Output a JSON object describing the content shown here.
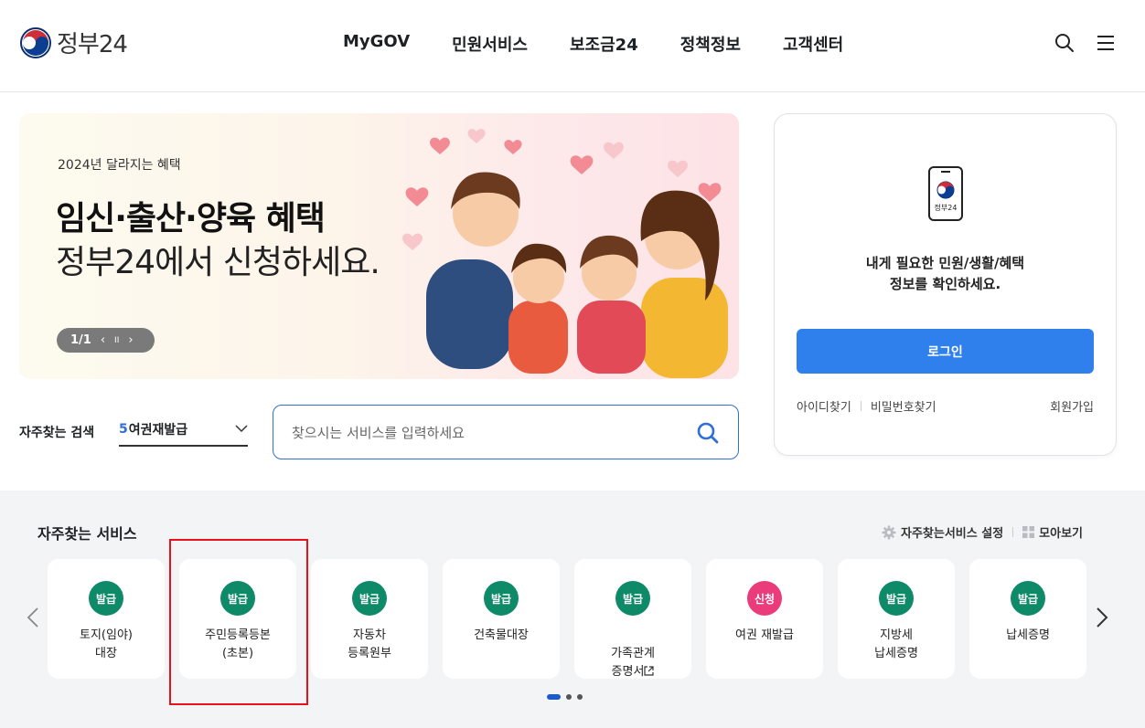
{
  "header": {
    "logo_text": "정부24",
    "nav": [
      "MyGOV",
      "민원서비스",
      "보조금24",
      "정책정보",
      "고객센터"
    ]
  },
  "banner": {
    "subtitle": "2024년 달라지는 혜택",
    "title": "임신·출산·양육 혜택",
    "title2": "정부24에서 신청하세요.",
    "counter": "1/1",
    "prev": "‹",
    "pause": "II",
    "next": "›"
  },
  "login": {
    "phone_label": "정부24",
    "message_line1": "내게 필요한 민원/생활/혜택",
    "message_line2": "정보를 확인하세요.",
    "button": "로그인",
    "find_id": "아이디찾기",
    "find_pw": "비밀번호찾기",
    "signup": "회원가입"
  },
  "search": {
    "label": "자주찾는 검색",
    "keyword_rank": "5",
    "keyword_text": "여권재발급",
    "placeholder": "찾으시는 서비스를 입력하세요"
  },
  "services": {
    "title": "자주찾는 서비스",
    "settings": "자주찾는서비스 설정",
    "view_all": "모아보기",
    "cards": [
      {
        "badge": "발급",
        "label": "토지(임야)\n대장"
      },
      {
        "badge": "발급",
        "label": "주민등록등본\n(초본)"
      },
      {
        "badge": "발급",
        "label": "자동차\n등록원부"
      },
      {
        "badge": "발급",
        "label": "건축물대장"
      },
      {
        "badge": "발급",
        "label": "가족관계\n증명서"
      },
      {
        "badge": "신청",
        "label": "여권 재발급"
      },
      {
        "badge": "발급",
        "label": "지방세\n납세증명"
      },
      {
        "badge": "발급",
        "label": "납세증명"
      }
    ],
    "pagination_active": 1,
    "pagination_total": 3
  },
  "colors": {
    "primary_blue": "#2f80ed",
    "badge_green": "#0e8a68",
    "badge_pink": "#ea3b7b",
    "highlight_red": "#e8101a"
  }
}
